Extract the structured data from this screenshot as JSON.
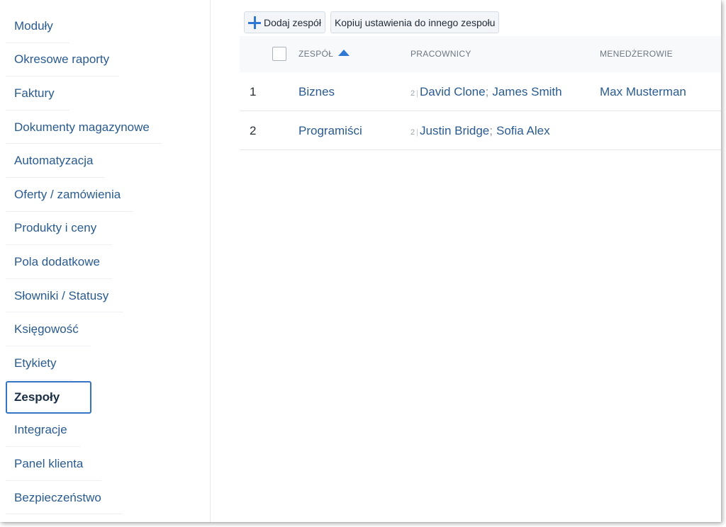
{
  "sidebar": {
    "items": [
      {
        "label": "Moduły"
      },
      {
        "label": "Okresowe raporty"
      },
      {
        "label": "Faktury"
      },
      {
        "label": "Dokumenty magazynowe"
      },
      {
        "label": "Automatyzacja"
      },
      {
        "label": "Oferty / zamówienia"
      },
      {
        "label": "Produkty i ceny"
      },
      {
        "label": "Pola dodatkowe"
      },
      {
        "label": "Słowniki / Statusy"
      },
      {
        "label": "Księgowość"
      },
      {
        "label": "Etykiety"
      },
      {
        "label": "Zespoły",
        "active": true
      },
      {
        "label": "Integracje"
      },
      {
        "label": "Panel klienta"
      },
      {
        "label": "Bezpieczeństwo"
      }
    ]
  },
  "toolbar": {
    "add_team_icon": "plus-icon",
    "add_team_label": "Dodaj zespół",
    "copy_settings_label": "Kopiuj ustawienia do innego zespołu"
  },
  "table": {
    "columns": {
      "team": "ZESPÓŁ",
      "workers": "PRACOWNICY",
      "managers": "MENEDŻEROWIE"
    },
    "sort": {
      "column": "team",
      "direction": "asc",
      "icon": "sort-up-icon"
    },
    "rows": [
      {
        "num": "1",
        "team": "Biznes",
        "workers_count": "2",
        "workers": [
          "David Clone",
          "James Smith"
        ],
        "managers": "Max Musterman"
      },
      {
        "num": "2",
        "team": "Programiści",
        "workers_count": "2",
        "workers": [
          "Justin Bridge",
          "Sofia Alex"
        ],
        "managers": ""
      }
    ],
    "separator": ";"
  },
  "colors": {
    "link": "#2a5b8f",
    "accent": "#2f78d3",
    "active_border": "#3374c4"
  }
}
